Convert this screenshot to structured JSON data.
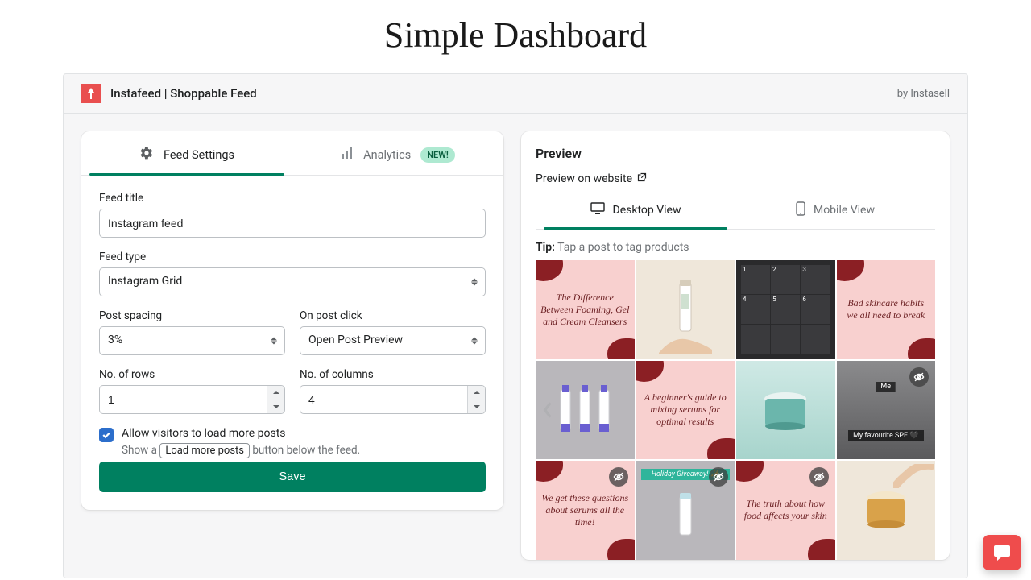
{
  "page_title": "Simple Dashboard",
  "app": {
    "name": "Instafeed | Shoppable Feed",
    "attribution": "by Instasell"
  },
  "tabs": {
    "feed_settings": "Feed Settings",
    "analytics": "Analytics",
    "new_badge": "NEW!"
  },
  "form": {
    "feed_title_label": "Feed title",
    "feed_title_value": "Instagram feed",
    "feed_type_label": "Feed type",
    "feed_type_value": "Instagram Grid",
    "post_spacing_label": "Post spacing",
    "post_spacing_value": "3%",
    "on_post_click_label": "On post click",
    "on_post_click_value": "Open Post Preview",
    "rows_label": "No. of rows",
    "rows_value": "1",
    "cols_label": "No. of columns",
    "cols_value": "4",
    "allow_more_label": "Allow visitors to load more posts",
    "allow_more_help_pre": "Show a ",
    "allow_more_pill": "Load more posts",
    "allow_more_help_post": " button below the feed.",
    "save": "Save"
  },
  "preview": {
    "title": "Preview",
    "link": "Preview on website",
    "desktop": "Desktop View",
    "mobile": "Mobile View",
    "tip_label": "Tip:",
    "tip_text": "Tap a post to tag products"
  },
  "tiles": [
    {
      "type": "pink_script",
      "text": "The Difference Between Foaming, Gel and Cream Cleansers"
    },
    {
      "type": "product_hand"
    },
    {
      "type": "collage"
    },
    {
      "type": "pink_script",
      "text": "Bad skincare habits we all need to break"
    },
    {
      "type": "tubes"
    },
    {
      "type": "pink_script",
      "text": "A beginner's guide to mixing serums for optimal results"
    },
    {
      "type": "jar_teal"
    },
    {
      "type": "spf_meme",
      "me": "Me",
      "caption": "My favourite SPF 🖤",
      "hidden": true
    },
    {
      "type": "pink_script",
      "text": "We get these questions about serums all the time!",
      "hidden": true
    },
    {
      "type": "giveaway",
      "banner": "Holiday Giveaway! ✨",
      "hidden": true
    },
    {
      "type": "pink_script",
      "text": "The truth about how food affects your skin",
      "hidden": true
    },
    {
      "type": "jar_cream"
    }
  ]
}
